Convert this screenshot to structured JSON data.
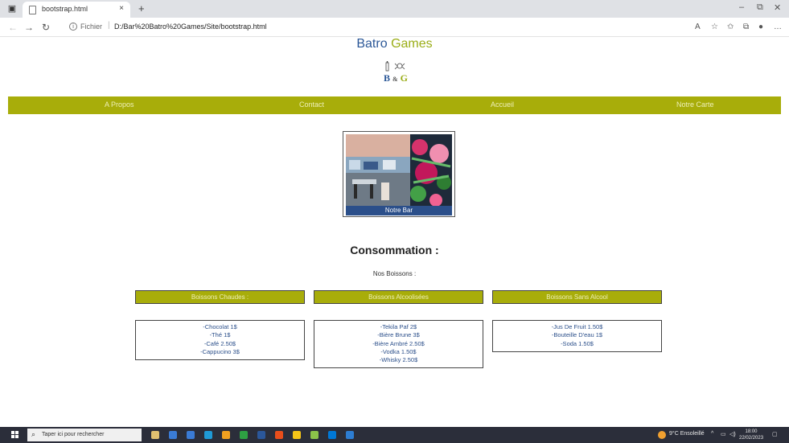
{
  "browser": {
    "tab_title": "bootstrap.html",
    "tab_close_glyph": "×",
    "new_tab_glyph": "+",
    "address_scheme": "Fichier",
    "address_url": "D:/Bar%20Batro%20Games/Site/bootstrap.html",
    "window_controls": {
      "minimize": "–",
      "restore": "⧉",
      "close": "✕"
    }
  },
  "header": {
    "brand_part1": "Batro",
    "brand_part2": "Games",
    "logo": {
      "letter1": "B",
      "amp": "&",
      "letter2": "G"
    }
  },
  "nav": {
    "items": [
      "A Propos",
      "Contact",
      "Accueil",
      "Notre Carte"
    ]
  },
  "feature": {
    "caption": "Notre Bar"
  },
  "main": {
    "title": "Consommation :",
    "subtitle": "Nos Boissons :"
  },
  "menus": [
    {
      "heading": "Boissons Chaudes :",
      "items": [
        "-Chocolat 1$",
        "-Thé 1$",
        "-Café 2.50$",
        "-Cappucino 3$"
      ]
    },
    {
      "heading": "Boissons Alcoolisées",
      "items": [
        "-Tekila Paf 2$",
        "-Bière Brune 3$",
        "-Bière Ambré 2.50$",
        "-Vodka 1.50$",
        "-Whisky 2.50$"
      ]
    },
    {
      "heading": "Boissons Sans Alcool",
      "items": [
        "-Jus De Fruit 1.50$",
        "-Bouteille D'eau 1$",
        "-Soda 1.50$"
      ]
    }
  ],
  "taskbar": {
    "search_placeholder": "Taper ici pour rechercher",
    "weather": "9°C Ensoleillé",
    "time": "18:00",
    "date": "22/02/2023",
    "app_colors": [
      "#e0c070",
      "#3a7bd5",
      "#3a7bd5",
      "#1f9ad6",
      "#f0a020",
      "#2ea043",
      "#2b579a",
      "#e94e1b",
      "#f5c518",
      "#8bc34a",
      "#0078d7",
      "#2d7dd2"
    ]
  },
  "colors": {
    "accent_olive": "#a8ad0a",
    "brand_blue": "#2b5797",
    "brand_green": "#9aad16",
    "link_blue": "#2b4f8a"
  }
}
